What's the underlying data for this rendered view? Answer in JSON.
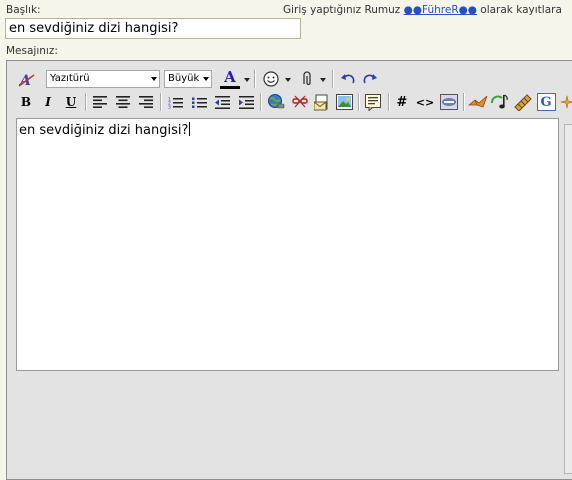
{
  "form": {
    "title_label": "Başlık:",
    "title_value": "en sevdiğiniz dizi hangisi?",
    "message_label": "Mesajınız:",
    "login_prefix": "Giriş yaptığınız Rumuz ",
    "login_user": "●●FühreR●●",
    "login_suffix": " olarak kayıtlara"
  },
  "toolbar": {
    "font_select": "Yazıtürü",
    "size_select": "Büyük",
    "text_color_letter": "A",
    "bold": "B",
    "italic": "I",
    "underline": "U",
    "hash": "#",
    "code": "<>",
    "google": "G"
  },
  "editor": {
    "content": "en sevdiğiniz dizi hangisi?"
  },
  "colors": {
    "accent_text": "#1c1cc4",
    "link": "#2a4fbf",
    "text_color_bar": "#000000"
  }
}
